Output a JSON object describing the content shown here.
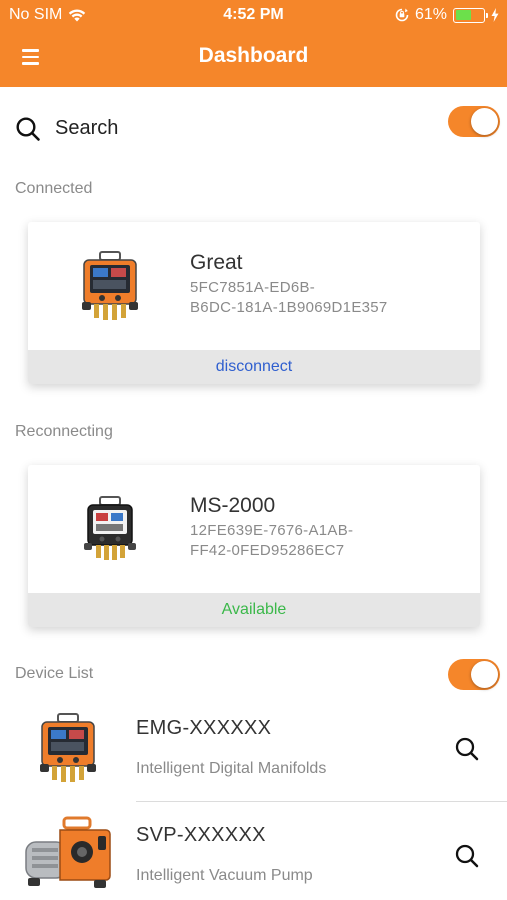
{
  "status_bar": {
    "carrier": "No SIM",
    "time": "4:52 PM",
    "battery": "61%",
    "battery_level": 0.61
  },
  "header": {
    "title": "Dashboard"
  },
  "search": {
    "label": "Search",
    "toggle_on": true
  },
  "connected": {
    "section_label": "Connected",
    "name": "Great",
    "id_line1": "5FC7851A-ED6B-",
    "id_line2": "B6DC-181A-1B9069D1E357",
    "action": "disconnect"
  },
  "reconnecting": {
    "section_label": "Reconnecting",
    "name": "MS-2000",
    "id_line1": "12FE639E-7676-A1AB-",
    "id_line2": "FF42-0FED95286EC7",
    "status": "Available"
  },
  "device_list": {
    "section_label": "Device List",
    "toggle_on": true,
    "items": [
      {
        "name": "EMG-XXXXXX",
        "description": "Intelligent Digital Manifolds"
      },
      {
        "name": "SVP-XXXXXX",
        "description": "Intelligent Vacuum Pump"
      }
    ]
  },
  "colors": {
    "accent": "#f5862a",
    "link_blue": "#2f5fcf",
    "available_green": "#3bb84a"
  },
  "icons": {
    "menu": "hamburger-menu-icon",
    "search": "magnifier-icon",
    "wifi": "wifi-icon",
    "battery": "battery-icon"
  }
}
